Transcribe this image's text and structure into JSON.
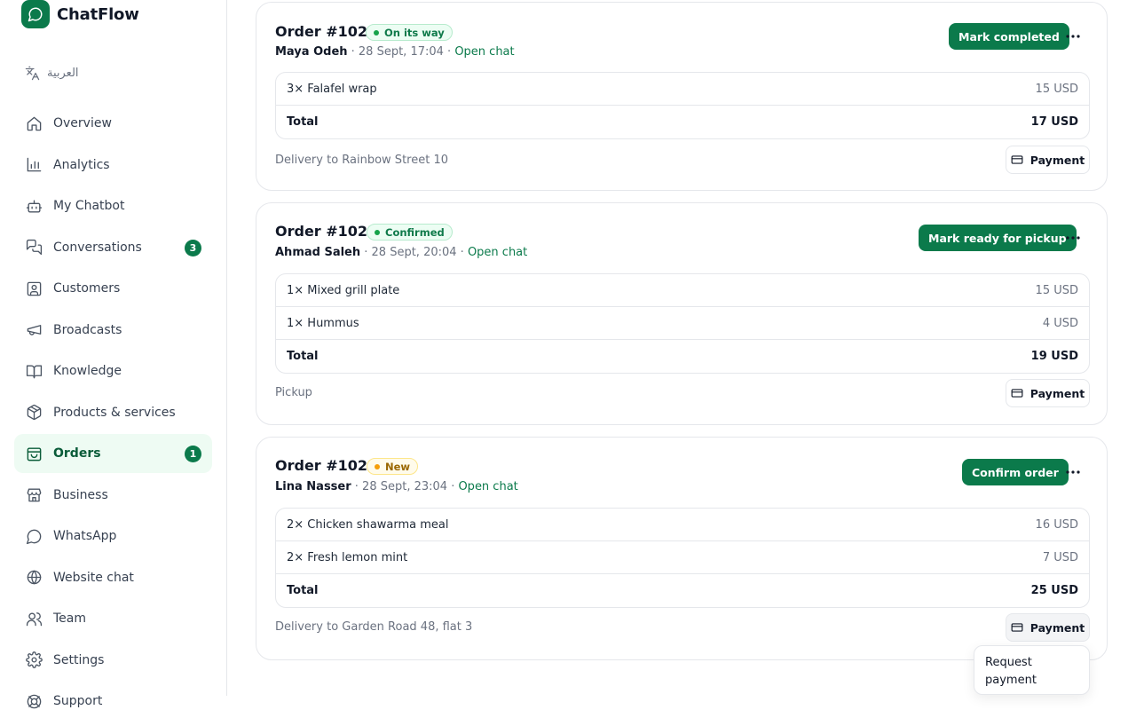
{
  "brand": {
    "name": "ChatFlow",
    "logo_icon": "chat-bubble-icon"
  },
  "language": {
    "label": "العربية",
    "icon": "translate-icon"
  },
  "nav": [
    {
      "key": "overview",
      "label": "Overview",
      "icon": "home-icon"
    },
    {
      "key": "analytics",
      "label": "Analytics",
      "icon": "bar-chart-icon"
    },
    {
      "key": "chatbot",
      "label": "My Chatbot",
      "icon": "bot-icon"
    },
    {
      "key": "conversations",
      "label": "Conversations",
      "icon": "messages-icon",
      "badge": "3"
    },
    {
      "key": "customers",
      "label": "Customers",
      "icon": "contact-icon"
    },
    {
      "key": "broadcasts",
      "label": "Broadcasts",
      "icon": "megaphone-icon"
    },
    {
      "key": "knowledge",
      "label": "Knowledge",
      "icon": "book-icon"
    },
    {
      "key": "products",
      "label": "Products & services",
      "icon": "package-icon"
    },
    {
      "key": "orders",
      "label": "Orders",
      "icon": "shopping-bag-icon",
      "badge": "1",
      "active": true
    },
    {
      "key": "business",
      "label": "Business",
      "icon": "store-icon"
    },
    {
      "key": "whatsapp",
      "label": "WhatsApp",
      "icon": "chat-circle-icon"
    },
    {
      "key": "website-chat",
      "label": "Website chat",
      "icon": "globe-icon"
    },
    {
      "key": "team",
      "label": "Team",
      "icon": "users-icon"
    },
    {
      "key": "settings",
      "label": "Settings",
      "icon": "gear-icon"
    },
    {
      "key": "support",
      "label": "Support",
      "icon": "lifebuoy-icon"
    }
  ],
  "orders": [
    {
      "id": "Order #1026",
      "status": "On its way",
      "status_color": "green",
      "customer": "Maya Odeh",
      "time": " · 28 Sept, 17:04 · ",
      "chat_link": "Open chat",
      "action": "Mark completed",
      "items": [
        {
          "name": "3× Falafel wrap",
          "price": "15 USD"
        }
      ],
      "total_label": "Total",
      "total": "17 USD",
      "delivery": "Delivery to Rainbow Street 10",
      "payment_label": "Payment"
    },
    {
      "id": "Order #1025",
      "status": "Confirmed",
      "status_color": "green",
      "customer": "Ahmad Saleh",
      "time": " · 28 Sept, 20:04 · ",
      "chat_link": "Open chat",
      "action": "Mark ready for pickup",
      "items": [
        {
          "name": "1× Mixed grill plate",
          "price": "15 USD"
        },
        {
          "name": "1× Hummus",
          "price": "4 USD"
        }
      ],
      "total_label": "Total",
      "total": "19 USD",
      "delivery": "Pickup",
      "payment_label": "Payment"
    },
    {
      "id": "Order #1024",
      "status": "New",
      "status_color": "yellow",
      "customer": "Lina Nasser",
      "time": " · 28 Sept, 23:04 · ",
      "chat_link": "Open chat",
      "action": "Confirm order",
      "items": [
        {
          "name": "2× Chicken shawarma meal",
          "price": "16 USD"
        },
        {
          "name": "2× Fresh lemon mint",
          "price": "7 USD"
        }
      ],
      "total_label": "Total",
      "total": "25 USD",
      "delivery": "Delivery to Garden Road 48, flat 3",
      "payment_label": "Payment"
    }
  ],
  "payment_menu": {
    "option": "Request payment"
  },
  "colors": {
    "brand": "#0b7a4b",
    "active_bg": "#eefbf3",
    "pending": "#f59e0b"
  }
}
